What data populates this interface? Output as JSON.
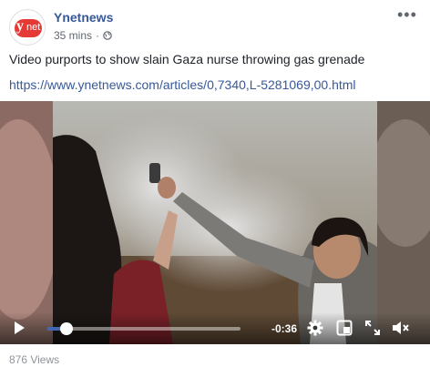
{
  "post": {
    "page_name": "Ynetnews",
    "time": "35 mins",
    "separator": "·",
    "audience_icon": "globe-icon",
    "more_icon": "more-options-icon",
    "text": "Video purports to show slain Gaza nurse throwing gas grenade",
    "link": "https://www.ynetnews.com/articles/0,7340,L-5281069,00.html",
    "avatar_logo_letter": "y",
    "avatar_logo_text": "net"
  },
  "video": {
    "time_remaining": "-0:36",
    "progress_fraction": 0.1,
    "controls": [
      "play-icon",
      "gear-icon",
      "picture-in-picture-icon",
      "fullscreen-icon",
      "volume-icon"
    ]
  },
  "footer": {
    "views": "876 Views"
  },
  "colors": {
    "link": "#385898",
    "page_name": "#365899",
    "progress": "#4267b2",
    "logo_red": "#e53935"
  }
}
